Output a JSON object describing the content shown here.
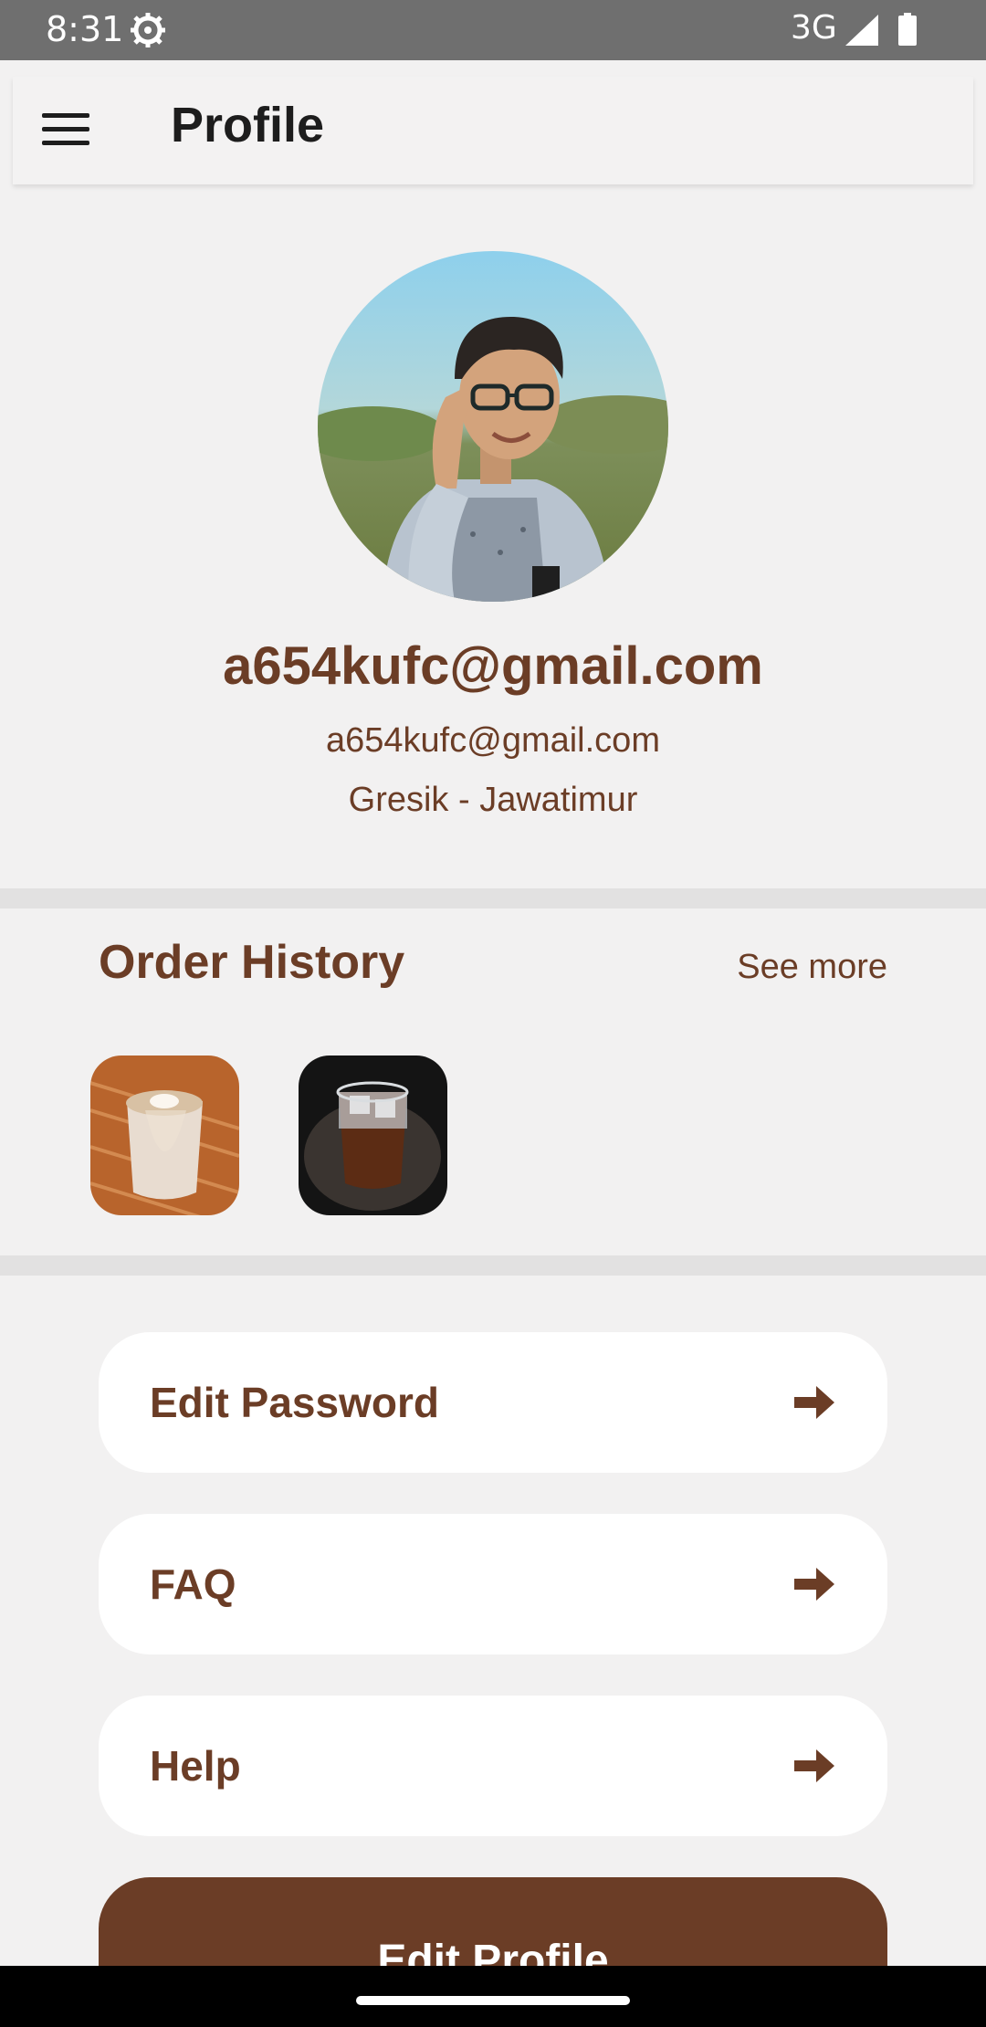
{
  "status_bar": {
    "time": "8:31",
    "network": "3G",
    "icons": [
      "settings-gear-icon",
      "signal-icon",
      "battery-icon"
    ]
  },
  "app_bar": {
    "title": "Profile",
    "menu_icon": "hamburger-menu-icon"
  },
  "profile": {
    "name": "a654kufc@gmail.com",
    "email": "a654kufc@gmail.com",
    "location": "Gresik - Jawatimur"
  },
  "order_history": {
    "title": "Order History",
    "see_more": "See more",
    "items": [
      "latte-photo",
      "iced-coffee-photo"
    ]
  },
  "menu": {
    "items": [
      {
        "label": "Edit Password",
        "icon": "arrow-right-icon"
      },
      {
        "label": "FAQ",
        "icon": "arrow-right-icon"
      },
      {
        "label": "Help",
        "icon": "arrow-right-icon"
      }
    ],
    "edit_profile_label": "Edit Profile"
  },
  "colors": {
    "accent": "#6b3d26",
    "background": "#f2f1f1",
    "card": "#ffffff",
    "status_bar": "#6f6f6f"
  }
}
